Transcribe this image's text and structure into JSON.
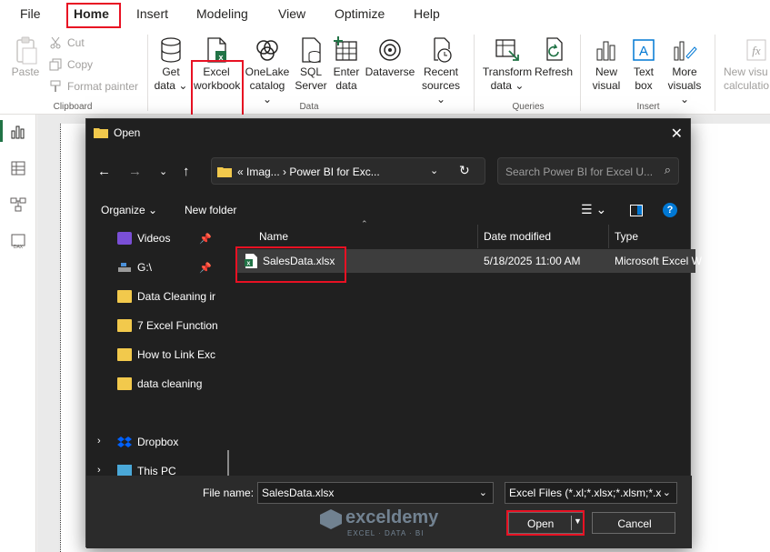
{
  "menu": {
    "items": [
      "File",
      "Home",
      "Insert",
      "Modeling",
      "View",
      "Optimize",
      "Help"
    ],
    "active": "Home"
  },
  "ribbon": {
    "clipboard": {
      "paste": "Paste",
      "cut": "Cut",
      "copy": "Copy",
      "format_painter": "Format painter",
      "group": "Clipboard"
    },
    "data": {
      "get_data": [
        "Get",
        "data ⌄"
      ],
      "excel_workbook": [
        "Excel",
        "workbook"
      ],
      "onelake": [
        "OneLake",
        "catalog ⌄"
      ],
      "sql": [
        "SQL",
        "Server"
      ],
      "enter_data": [
        "Enter",
        "data"
      ],
      "dataverse": [
        "Dataverse"
      ],
      "recent_sources": [
        "Recent",
        "sources ⌄"
      ],
      "group": "Data"
    },
    "queries": {
      "transform": [
        "Transform",
        "data ⌄"
      ],
      "refresh": [
        "Refresh"
      ],
      "group": "Queries"
    },
    "insert": {
      "new_visual": [
        "New",
        "visual"
      ],
      "text_box": [
        "Text",
        "box"
      ],
      "more_visuals": [
        "More",
        "visuals ⌄"
      ],
      "new_visual_calc": [
        "New visu",
        "calculatio"
      ],
      "group": "Insert"
    }
  },
  "dialog": {
    "title": "Open",
    "breadcrumb": "«  Imag...  ›  Power BI for Exc...",
    "search_placeholder": "Search Power BI for Excel U...",
    "organize": "Organize ⌄",
    "new_folder": "New folder",
    "nav_items": [
      {
        "label": "Videos",
        "pinned": true
      },
      {
        "label": "G:\\",
        "pinned": true
      },
      {
        "label": "Data Cleaning ir"
      },
      {
        "label": "7 Excel Function"
      },
      {
        "label": "How to Link Exc"
      },
      {
        "label": "data cleaning"
      },
      {
        "label": "Dropbox"
      },
      {
        "label": "This PC"
      }
    ],
    "columns": {
      "name": "Name",
      "date": "Date modified",
      "type": "Type"
    },
    "files": [
      {
        "name": "SalesData.xlsx",
        "date": "5/18/2025 11:00 AM",
        "type": "Microsoft Excel W"
      }
    ],
    "file_name_label": "File name:",
    "file_name_value": "SalesData.xlsx",
    "file_type_filter": "Excel Files (*.xl;*.xlsx;*.xlsm;*.xls",
    "open_button": "Open",
    "cancel_button": "Cancel"
  },
  "watermark": {
    "brand": "exceldemy",
    "tagline": "EXCEL · DATA · BI"
  },
  "colors": {
    "highlight": "#e81123",
    "excel_green": "#217346",
    "dialog_bg": "#202020",
    "folder": "#f2c94c"
  }
}
